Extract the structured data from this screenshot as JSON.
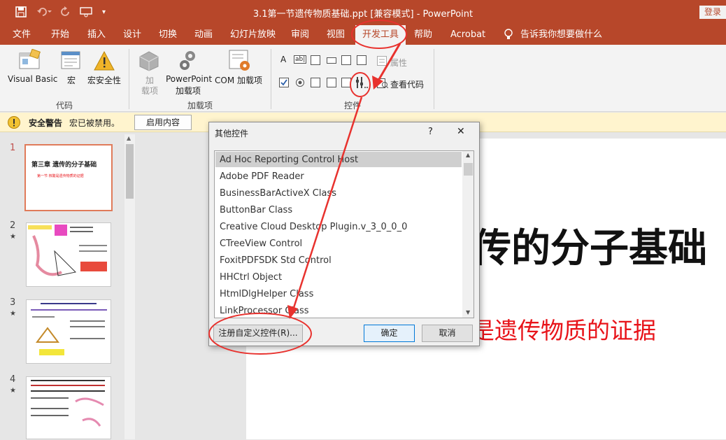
{
  "titlebar": {
    "document_title": "3.1第一节遗传物质基础.ppt [兼容模式] - PowerPoint",
    "login_label": "登录"
  },
  "tabs": [
    "文件",
    "开始",
    "插入",
    "设计",
    "切换",
    "动画",
    "幻灯片放映",
    "审阅",
    "视图",
    "开发工具",
    "帮助",
    "Acrobat"
  ],
  "tell_me": "告诉我你想要做什么",
  "ribbon": {
    "code": {
      "visual_basic": "Visual Basic",
      "macros": "宏",
      "macro_security": "宏安全性",
      "group_label": "代码"
    },
    "addins": {
      "addins_1": "加",
      "addins_2": "载项",
      "ppt_addins_1": "PowerPoint",
      "ppt_addins_2": "加载项",
      "com_addins": "COM 加载项",
      "group_label": "加载项"
    },
    "controls": {
      "properties": "属性",
      "view_code": "查看代码",
      "group_label": "控件"
    }
  },
  "message_bar": {
    "title": "安全警告",
    "text": "宏已被禁用。",
    "button": "启用内容"
  },
  "slides": [
    {
      "num": "1",
      "title": "第三章 遗传的分子基础",
      "subtitle": "第一节  核酸是遗传物质的证据"
    },
    {
      "num": "2",
      "star": "★"
    },
    {
      "num": "3",
      "star": "★"
    },
    {
      "num": "4",
      "star": "★"
    }
  ],
  "main_slide": {
    "title_fragment": "传的分子基础",
    "subtitle_fragment": "是遗传物质的证据"
  },
  "dialog": {
    "title": "其他控件",
    "help": "?",
    "close": "✕",
    "items": [
      "Ad Hoc Reporting Control Host",
      "Adobe PDF Reader",
      "BusinessBarActiveX Class",
      "ButtonBar Class",
      "Creative Cloud Desktop Plugin.v_3_0_0_0",
      "CTreeView Control",
      "FoxitPDFSDK Std Control",
      "HHCtrl Object",
      "HtmlDlgHelper Class",
      "LinkProcessor Class"
    ],
    "register_button": "注册自定义控件(R)...",
    "ok_button": "确定",
    "cancel_button": "取消"
  },
  "colors": {
    "brand": "#b7472a",
    "annotation": "#e8322e",
    "slide_red": "#e8141a"
  }
}
